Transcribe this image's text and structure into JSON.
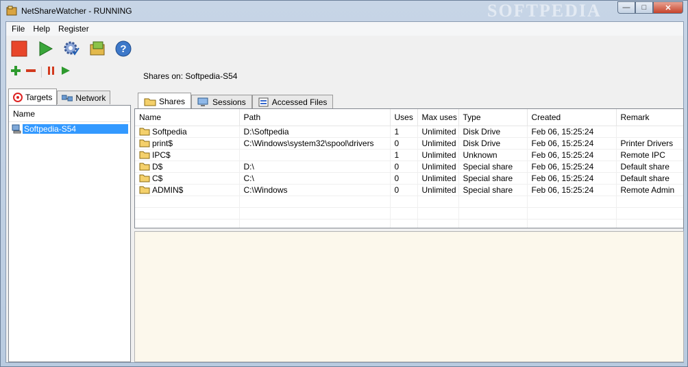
{
  "window": {
    "title": "NetShareWatcher - RUNNING",
    "watermark": "SOFTPEDIA",
    "caption": {
      "minimize": "—",
      "maximize": "□",
      "close": "✕"
    }
  },
  "menu": [
    "File",
    "Help",
    "Register"
  ],
  "toolbar": {
    "icons": [
      "stop-icon",
      "play-icon",
      "settings-icon",
      "log-icon",
      "help-icon"
    ]
  },
  "left": {
    "mini_toolbar": [
      "add-icon",
      "remove-icon",
      "pause-icon",
      "play-icon"
    ],
    "tabs": [
      {
        "label": "Targets",
        "active": true
      },
      {
        "label": "Network",
        "active": false
      }
    ],
    "list_header": "Name",
    "items": [
      "Softpedia-S54"
    ]
  },
  "right": {
    "shares_on": "Shares on: Softpedia-S54",
    "tabs": [
      {
        "label": "Shares",
        "active": true
      },
      {
        "label": "Sessions",
        "active": false
      },
      {
        "label": "Accessed Files",
        "active": false
      }
    ],
    "columns": [
      "Name",
      "Path",
      "Uses",
      "Max uses",
      "Type",
      "Created",
      "Remark"
    ],
    "rows": [
      [
        "Softpedia",
        "D:\\Softpedia",
        "1",
        "Unlimited",
        "Disk Drive",
        "Feb 06, 15:25:24",
        ""
      ],
      [
        "print$",
        "C:\\Windows\\system32\\spool\\drivers",
        "0",
        "Unlimited",
        "Disk Drive",
        "Feb 06, 15:25:24",
        "Printer Drivers"
      ],
      [
        "IPC$",
        "",
        "1",
        "Unlimited",
        "Unknown",
        "Feb 06, 15:25:24",
        "Remote IPC"
      ],
      [
        "D$",
        "D:\\",
        "0",
        "Unlimited",
        "Special share",
        "Feb 06, 15:25:24",
        "Default share"
      ],
      [
        "C$",
        "C:\\",
        "0",
        "Unlimited",
        "Special share",
        "Feb 06, 15:25:24",
        "Default share"
      ],
      [
        "ADMIN$",
        "C:\\Windows",
        "0",
        "Unlimited",
        "Special share",
        "Feb 06, 15:25:24",
        "Remote Admin"
      ]
    ]
  },
  "colors": {
    "selection": "#3399ff",
    "detail_bg": "#fcf8ec"
  }
}
